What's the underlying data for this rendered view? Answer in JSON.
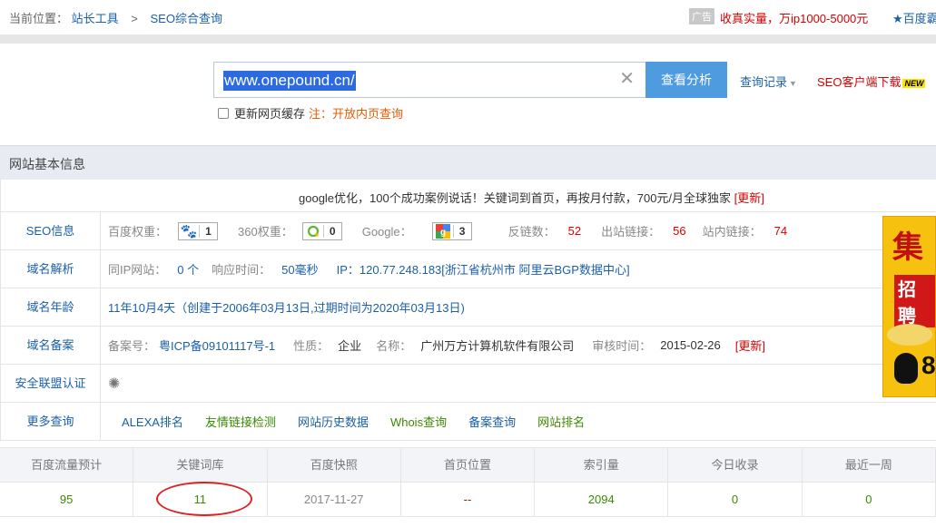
{
  "breadcrumb": {
    "prefix": "当前位置：",
    "items": [
      "站长工具",
      "SEO综合查询"
    ],
    "separator": ">"
  },
  "ad": {
    "tag": "广告",
    "text": "收真实量，万ip1000-5000元",
    "right": "★百度霸"
  },
  "search": {
    "value": "www.onepound.cn/",
    "button": "查看分析",
    "history": "查询记录",
    "client_download": "SEO客户端下载",
    "new_badge": "NEW",
    "cache_label": "更新网页缓存",
    "cache_note": "注：开放内页查询"
  },
  "section_title": "网站基本信息",
  "promo": {
    "text": "google优化，100个成功案例说话！关键词到首页，再按月付款，700元/月全球独家",
    "update": "[更新]"
  },
  "seo": {
    "label": "SEO信息",
    "baidu_k": "百度权重：",
    "baidu_v": "1",
    "s360_k": "360权重：",
    "s360_v": "0",
    "google_k": "Google：",
    "google_v": "3",
    "backlinks_k": "反链数：",
    "backlinks_v": "52",
    "outlinks_k": "出站链接：",
    "outlinks_v": "56",
    "inlinks_k": "站内链接：",
    "inlinks_v": "74"
  },
  "dns": {
    "label": "域名解析",
    "sameip_k": "同IP网站：",
    "sameip_v": "0 个",
    "resp_k": "响应时间：",
    "resp_v": "50毫秒",
    "ip": "IP：120.77.248.183[浙江省杭州市 阿里云BGP数据中心]"
  },
  "age": {
    "label": "域名年龄",
    "text": "11年10月4天（创建于2006年03月13日,过期时间为2020年03月13日)"
  },
  "icp": {
    "label": "域名备案",
    "no_k": "备案号：",
    "no_v": "粤ICP备09101117号-1",
    "type_k": "性质：",
    "type_v": "企业",
    "name_k": "名称：",
    "name_v": "广州万方计算机软件有限公司",
    "date_k": "审核时间：",
    "date_v": "2015-02-26",
    "update": "[更新]"
  },
  "security": {
    "label": "安全联盟认证"
  },
  "more": {
    "label": "更多查询",
    "links": [
      "ALEXA排名",
      "友情链接检测",
      "网站历史数据",
      "Whois查询",
      "备案查询",
      "网站排名"
    ]
  },
  "banner": {
    "t1": "集",
    "t2": "招聘",
    "t3": "8"
  },
  "stats": {
    "headers": [
      "百度流量预计",
      "关键词库",
      "百度快照",
      "首页位置",
      "索引量",
      "今日收录",
      "最近一周"
    ],
    "values": [
      "95",
      "11",
      "2017-11-27",
      "--",
      "2094",
      "0",
      "0"
    ]
  },
  "colors": {
    "link": "#1a5fa8",
    "red": "#d40000",
    "green": "#3a8a00",
    "button": "#4f9bdf"
  }
}
